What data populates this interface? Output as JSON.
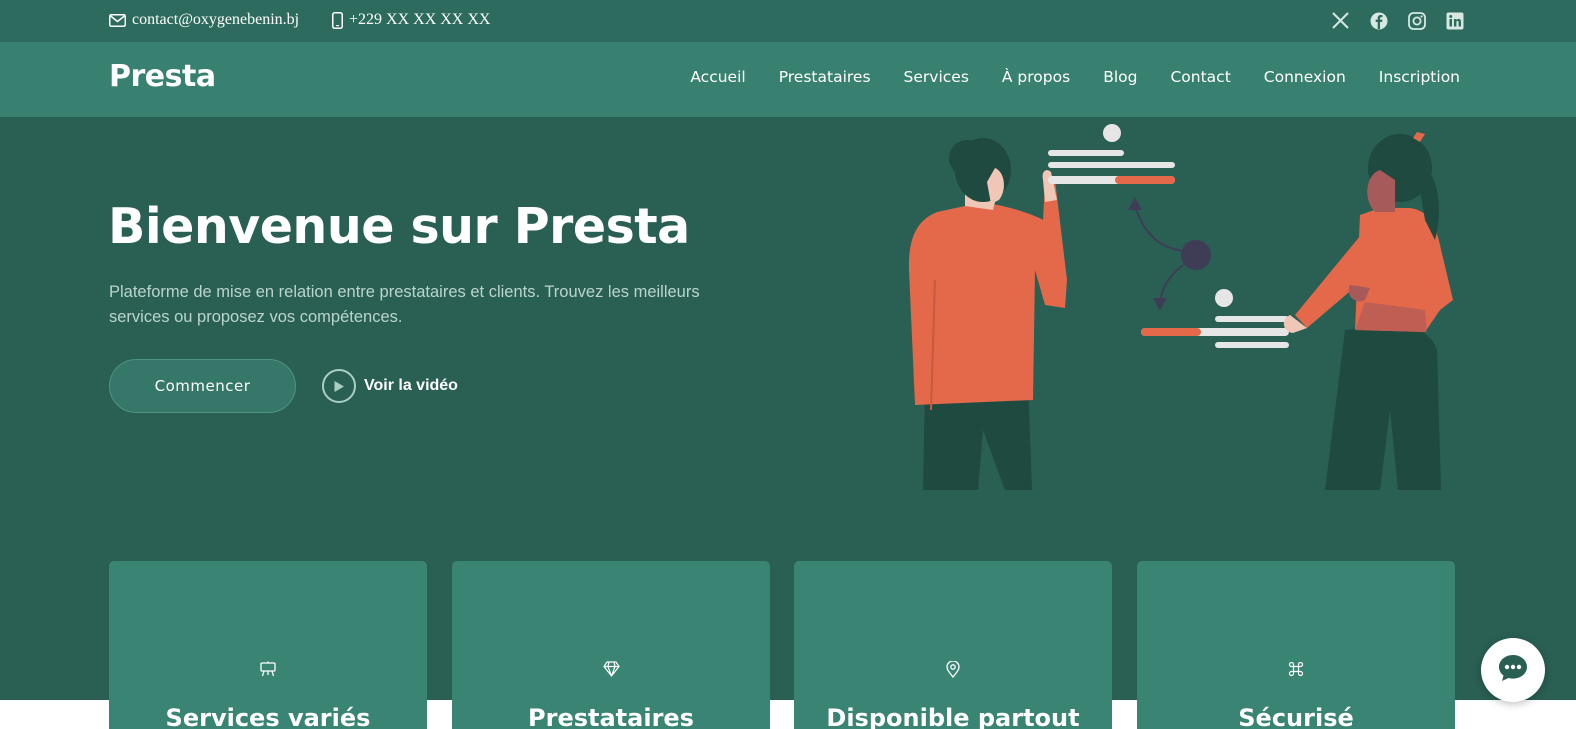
{
  "topbar": {
    "email": "contact@oxygenebenin.bj",
    "phone": "+229  XX  XX  XX  XX",
    "socials": [
      "x-icon",
      "facebook-icon",
      "instagram-icon",
      "linkedin-icon"
    ]
  },
  "nav": {
    "brand": "Presta",
    "links": [
      "Accueil",
      "Prestataires",
      "Services",
      "À propos",
      "Blog",
      "Contact",
      "Connexion",
      "Inscription"
    ]
  },
  "hero": {
    "title": "Bienvenue sur Presta",
    "subtitle": "Plateforme de mise en relation entre prestataires et clients. Trouvez les meilleurs services ou proposez vos compétences.",
    "cta_label": "Commencer",
    "video_label": "Voir la vidéo"
  },
  "features": [
    {
      "title": "Services variés",
      "icon": "easel-icon"
    },
    {
      "title": "Prestataires",
      "icon": "diamond-icon"
    },
    {
      "title": "Disponible partout",
      "icon": "map-pin-icon"
    },
    {
      "title": "Sécurisé",
      "icon": "command-icon"
    }
  ],
  "colors": {
    "hero_bg": "#2a5f54",
    "topbar_bg": "#2d6b5e",
    "nav_bg": "#38806f",
    "card_bg": "#3a8474",
    "accent": "#e4684a"
  }
}
